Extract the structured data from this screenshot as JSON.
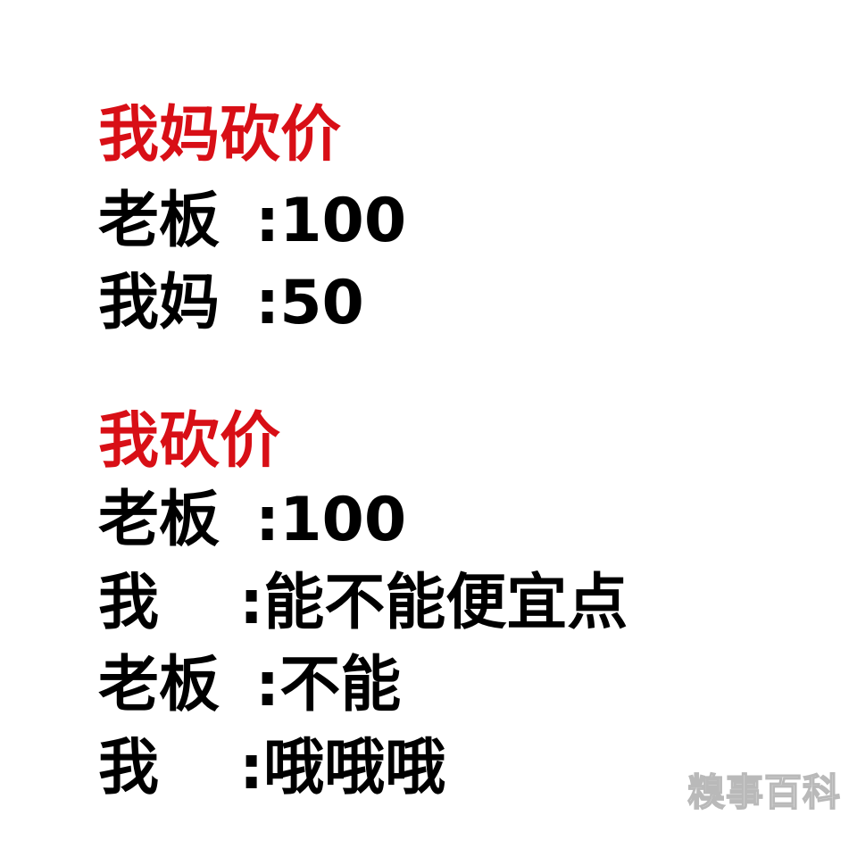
{
  "colors": {
    "heading": "#d80f16",
    "text": "#000000",
    "background": "#ffffff"
  },
  "section1": {
    "title": "我妈砍价",
    "lines": [
      {
        "speaker": "老板",
        "speech": ":100"
      },
      {
        "speaker": "我妈",
        "speech": ":50"
      }
    ]
  },
  "section2": {
    "title": "我砍价",
    "lines": [
      {
        "speaker": "老板",
        "speech": ":100"
      },
      {
        "speaker": "我",
        "speech": ":能不能便宜点"
      },
      {
        "speaker": "老板",
        "speech": ":不能"
      },
      {
        "speaker": "我",
        "speech": ":哦哦哦"
      }
    ]
  },
  "watermark": {
    "text": "糗事百科"
  }
}
